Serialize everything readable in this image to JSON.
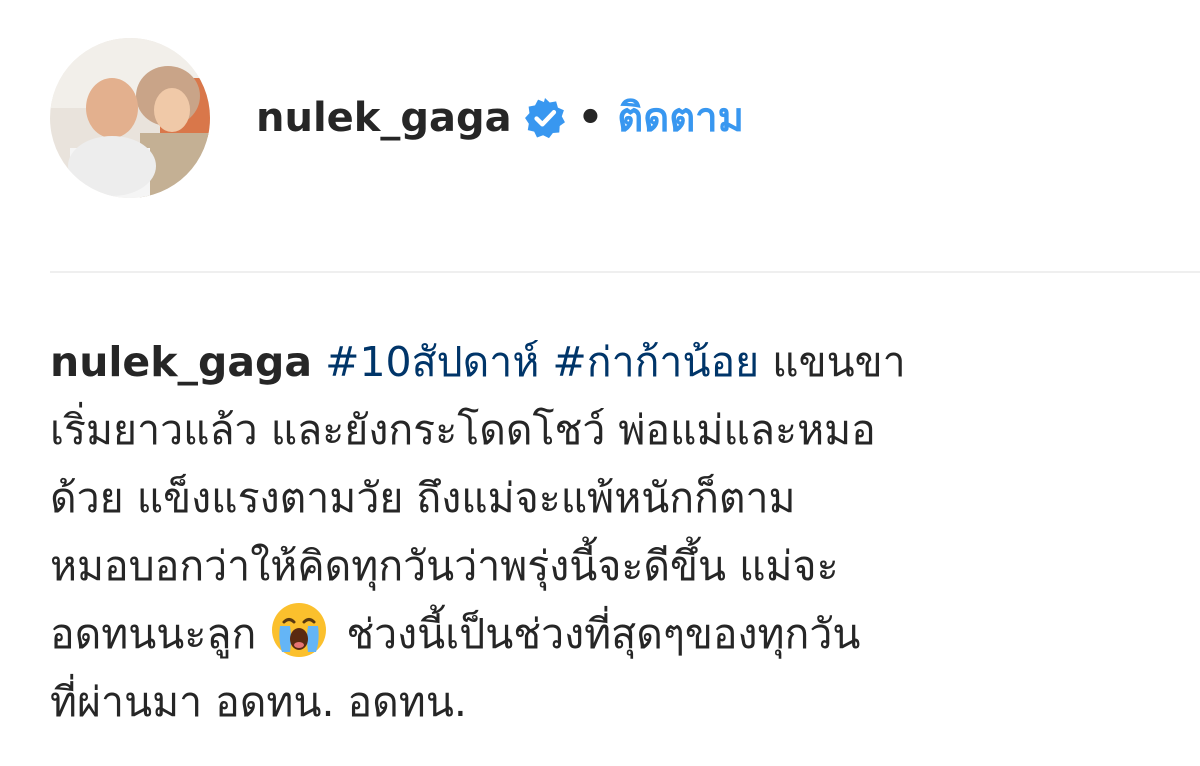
{
  "post": {
    "username": "nulek_gaga",
    "separator": "•",
    "follow_label": "ติดตาม",
    "verified_icon": "verified-badge-icon",
    "accent_color": "#3897f0",
    "hashtag_color": "#003569"
  },
  "caption": {
    "username": "nulek_gaga",
    "hashtags": [
      "#10สัปดาห์",
      "#ก่าก้าน้อย"
    ],
    "line1_rest": "แขนขา",
    "line2": "เริ่มยาวแล้ว และยังกระโดดโชว์ พ่อแม่และหมอ",
    "line3": "ด้วย แข็งแรงตามวัย ถึงแม่จะแพ้หนักก็ตาม",
    "line4": "หมอบอกว่าให้คิดทุกวันว่าพรุ่งนี้จะดีขึ้น แม่จะ",
    "line5_before_emoji": "อดทนนะลูก",
    "emoji": "loudly-crying-face-emoji",
    "line5_after_emoji": "ช่วงนี้เป็นช่วงที่สุดๆของทุกวัน",
    "line6": "ที่ผ่านมา อดทน. อดทน."
  }
}
